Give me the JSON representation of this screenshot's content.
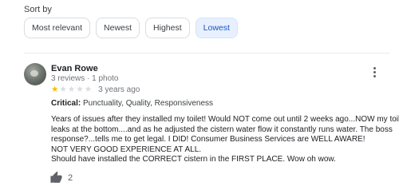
{
  "sort": {
    "label": "Sort by",
    "options": [
      "Most relevant",
      "Newest",
      "Highest",
      "Lowest"
    ],
    "selected": "Lowest"
  },
  "review": {
    "author": "Evan Rowe",
    "meta": "3 reviews · 1 photo",
    "rating": 1,
    "rating_max": 5,
    "date": "3 years ago",
    "critical_label": "Critical:",
    "critical_values": "Punctuality, Quality, Responsiveness",
    "text_lines": [
      "Years of issues after they installed my toilet! Would NOT come out until 2 weeks ago...NOW my toilet",
      "leaks at the bottom....and as he adjusted the cistern water flow it constantly runs water. The boss",
      "response?...tells me to get legal. I DID!  Consumer Business Services are WELL AWARE!",
      "NOT VERY GOOD EXPERIENCE AT ALL.",
      "Should have installed the CORRECT cistern in the FIRST PLACE. Wow oh wow."
    ],
    "likes": "2"
  },
  "icons": {
    "more": "more-vert-icon",
    "like": "thumbs-up-icon",
    "star": "star-icon"
  },
  "colors": {
    "star": "#fbbc04",
    "selected_chip_bg": "#e8f0fe",
    "selected_chip_text": "#1a56c4"
  }
}
